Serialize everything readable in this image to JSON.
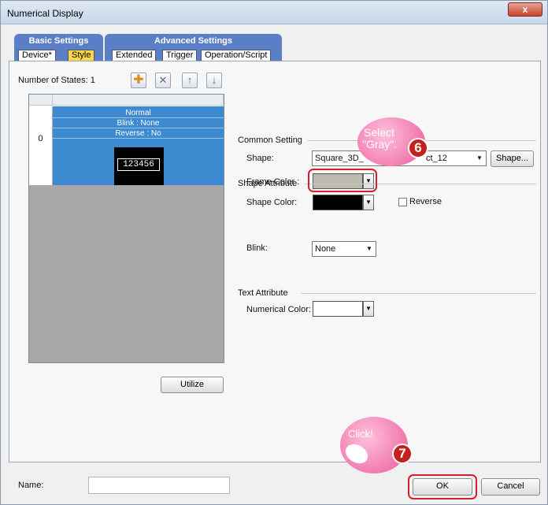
{
  "window": {
    "title": "Numerical Display",
    "close_label": "x"
  },
  "tabs": {
    "basic": {
      "label": "Basic Settings",
      "sub": [
        "Device*",
        "Style"
      ]
    },
    "advanced": {
      "label": "Advanced Settings",
      "sub": [
        "Extended",
        "Trigger",
        "Operation/Script"
      ]
    }
  },
  "states": {
    "count_label": "Number of States: 1",
    "row_index": "0",
    "lines": [
      "Normal",
      "Blink : None",
      "Reverse : No"
    ],
    "preview_value": "123456",
    "utilize_label": "Utilize"
  },
  "common_setting": {
    "group_label": "Common Setting",
    "shape_label": "Shape:",
    "shape_value_left": "Square_3D_",
    "shape_value_right": "ct_12",
    "shape_button": "Shape...",
    "frame_color_label": "Frame Color :",
    "frame_color": "#bdbab0"
  },
  "shape_attribute": {
    "group_label": "Shape Attribute",
    "shape_color_label": "Shape Color:",
    "shape_color": "#000000",
    "reverse_label": "Reverse",
    "blink_label": "Blink:",
    "blink_value": "None"
  },
  "text_attribute": {
    "group_label": "Text Attribute",
    "numerical_color_label": "Numerical Color:",
    "numerical_color": "#ffffff"
  },
  "callouts": {
    "select": {
      "line1": "Select",
      "line2": "\"Gray\".",
      "step": "6"
    },
    "click": {
      "text": "Click!",
      "step": "7"
    }
  },
  "footer": {
    "name_label": "Name:",
    "ok_label": "OK",
    "cancel_label": "Cancel"
  },
  "colors": {
    "accent_tab": "#5a7fc6",
    "selected_state": "#3d8ad0",
    "highlight_frame": "#d81e2a"
  }
}
